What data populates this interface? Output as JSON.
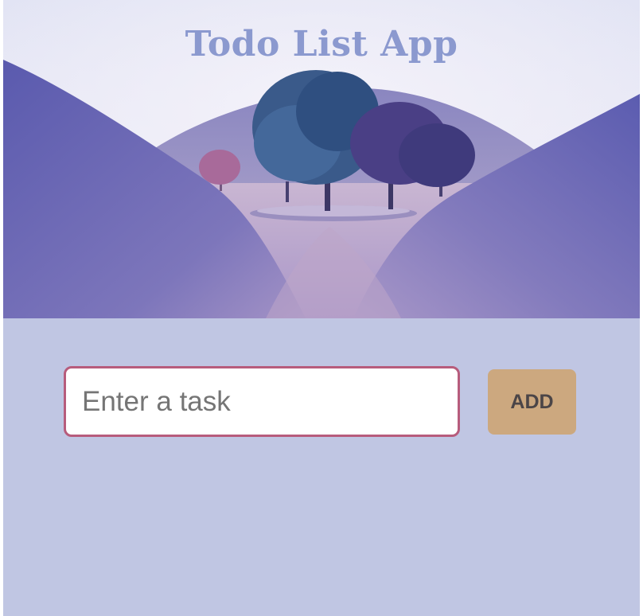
{
  "header": {
    "title": "Todo List App",
    "background_image": "grassy-hills-with-trees"
  },
  "form": {
    "input_placeholder": "Enter a task",
    "input_value": "",
    "add_label": "ADD"
  },
  "tasks": [],
  "colors": {
    "page_background": "#c0c6e3",
    "title_color": "#8b99cf",
    "input_border": "#b75c7c",
    "button_background": "#cca87f",
    "button_text": "#4b4547"
  }
}
